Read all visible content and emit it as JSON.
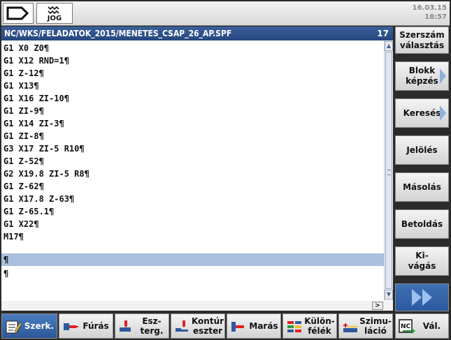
{
  "status_bar": {
    "mode_label": "JOG",
    "date": "16.03.15",
    "time": "18:57"
  },
  "program": {
    "path": "NC/WKS/FELADATOK_2015/MENETES_CSAP_26_AP.SPF",
    "line_number": "17",
    "lines": [
      "G1 X0 Z0¶",
      "G1 X12 RND=1¶",
      "G1 Z-12¶",
      "G1 X13¶",
      "G1 X16 ZI-10¶",
      "G1 ZI-9¶",
      "G1 X14 ZI-3¶",
      "G1 ZI-8¶",
      "G3 X17 ZI-5 R10¶",
      "G1 Z-52¶",
      "G2 X19.8 ZI-5 R8¶",
      "G1 Z-62¶",
      "G1 X17.8 Z-63¶",
      "G1 Z-65.1¶",
      "G1 X22¶",
      "M17¶",
      "¶",
      "¶"
    ],
    "selected_line_index": 16
  },
  "right_softkeys": [
    {
      "label": "Szerszám\nválasztás",
      "chevron": false
    },
    {
      "label": "Blokk\nképzés",
      "chevron": true
    },
    {
      "label": "Keresés",
      "chevron": true
    },
    {
      "label": "Jelölés",
      "chevron": false
    },
    {
      "label": "Másolás",
      "chevron": false
    },
    {
      "label": "Betoldás",
      "chevron": false
    },
    {
      "label": "Ki-\nvágás",
      "chevron": false
    }
  ],
  "bottom_softkeys": [
    {
      "label": "Szerk.",
      "icon": "edit-icon"
    },
    {
      "label": "Fúrás",
      "icon": "drilling-icon"
    },
    {
      "label": "Esz-\nterg.",
      "icon": "turning-icon"
    },
    {
      "label": "Kontúr\neszter",
      "icon": "contour-turning-icon"
    },
    {
      "label": "Marás",
      "icon": "milling-icon"
    },
    {
      "label": "Külön-\nfélék",
      "icon": "misc-icon"
    },
    {
      "label": "Szimu-\nláció",
      "icon": "simulation-icon"
    },
    {
      "label": "Vál.",
      "icon": "nc-select-icon"
    }
  ],
  "colors": {
    "header_blue": "#2f518b",
    "selection": "#a9c0de",
    "active_key": "#3a6aae"
  }
}
